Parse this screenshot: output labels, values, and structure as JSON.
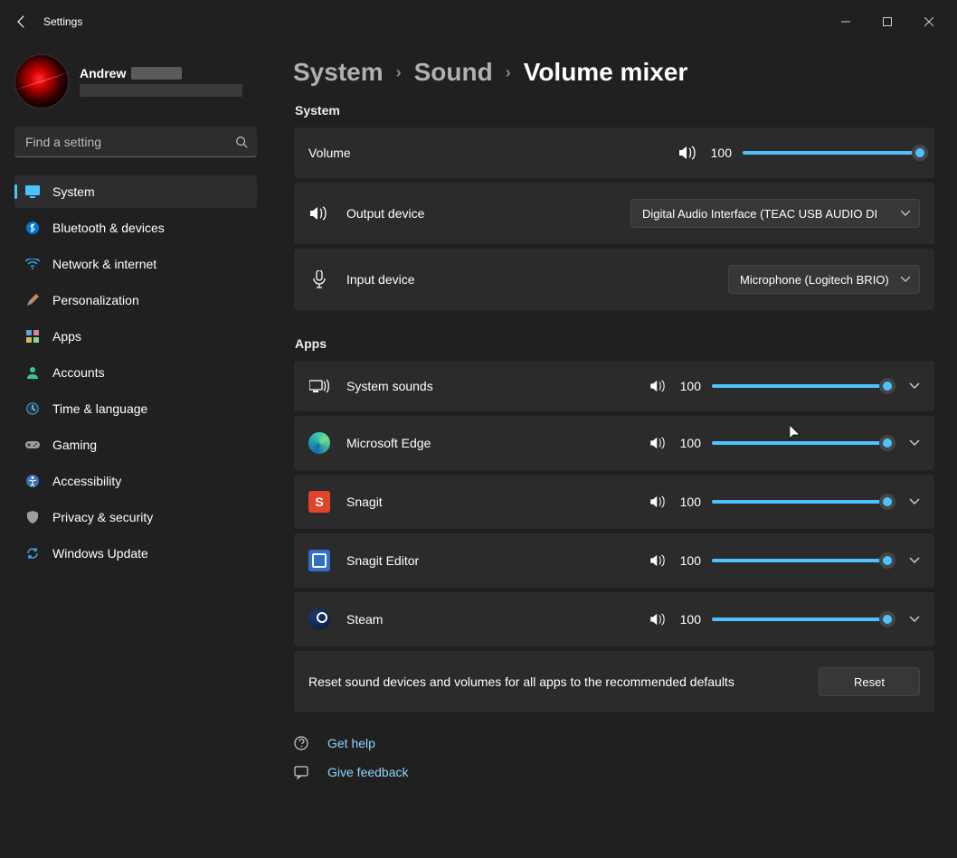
{
  "window": {
    "title": "Settings"
  },
  "user": {
    "name": "Andrew"
  },
  "search": {
    "placeholder": "Find a setting"
  },
  "nav": {
    "items": [
      {
        "label": "System"
      },
      {
        "label": "Bluetooth & devices"
      },
      {
        "label": "Network & internet"
      },
      {
        "label": "Personalization"
      },
      {
        "label": "Apps"
      },
      {
        "label": "Accounts"
      },
      {
        "label": "Time & language"
      },
      {
        "label": "Gaming"
      },
      {
        "label": "Accessibility"
      },
      {
        "label": "Privacy & security"
      },
      {
        "label": "Windows Update"
      }
    ]
  },
  "breadcrumb": {
    "root": "System",
    "mid": "Sound",
    "current": "Volume mixer"
  },
  "sections": {
    "system_label": "System",
    "apps_label": "Apps"
  },
  "system": {
    "volume": {
      "label": "Volume",
      "value": "100",
      "pct": 100
    },
    "output": {
      "label": "Output device",
      "value": "Digital Audio Interface (TEAC USB AUDIO DI"
    },
    "input": {
      "label": "Input device",
      "value": "Microphone (Logitech BRIO)"
    }
  },
  "apps": [
    {
      "name": "System sounds",
      "value": "100",
      "pct": 100,
      "icon": "system"
    },
    {
      "name": "Microsoft Edge",
      "value": "100",
      "pct": 100,
      "icon": "edge"
    },
    {
      "name": "Snagit",
      "value": "100",
      "pct": 100,
      "icon": "snagit"
    },
    {
      "name": "Snagit Editor",
      "value": "100",
      "pct": 100,
      "icon": "snagited"
    },
    {
      "name": "Steam",
      "value": "100",
      "pct": 100,
      "icon": "steam"
    }
  ],
  "reset": {
    "text": "Reset sound devices and volumes for all apps to the recommended defaults",
    "button": "Reset"
  },
  "footer": {
    "help": "Get help",
    "feedback": "Give feedback"
  },
  "colors": {
    "accent": "#4cc2ff",
    "bg": "#202020",
    "card": "#2b2b2b"
  }
}
